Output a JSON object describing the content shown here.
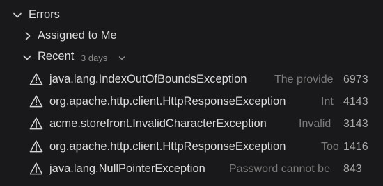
{
  "tree": {
    "errors_label": "Errors",
    "assigned_label": "Assigned to Me",
    "recent_label": "Recent",
    "recent_filter": "3 days"
  },
  "issues": [
    {
      "name": "java.lang.IndexOutOfBoundsException",
      "message": "The provide",
      "count": "6973"
    },
    {
      "name": "org.apache.http.client.HttpResponseException",
      "message": "Int",
      "count": "4143"
    },
    {
      "name": "acme.storefront.InvalidCharacterException",
      "message": "Invalid",
      "count": "3143"
    },
    {
      "name": "org.apache.http.client.HttpResponseException",
      "message": "Too",
      "count": "1416"
    },
    {
      "name": "java.lang.NullPointerException",
      "message": "Password cannot be",
      "count": "843"
    }
  ],
  "icons": {
    "expanded": "chevron-down-icon",
    "collapsed": "chevron-right-icon",
    "issue": "warning-icon"
  },
  "colors": {
    "background": "#19191b",
    "text": "#dcdcdc",
    "muted": "#7b7b7b",
    "count": "#a8a8a8"
  }
}
